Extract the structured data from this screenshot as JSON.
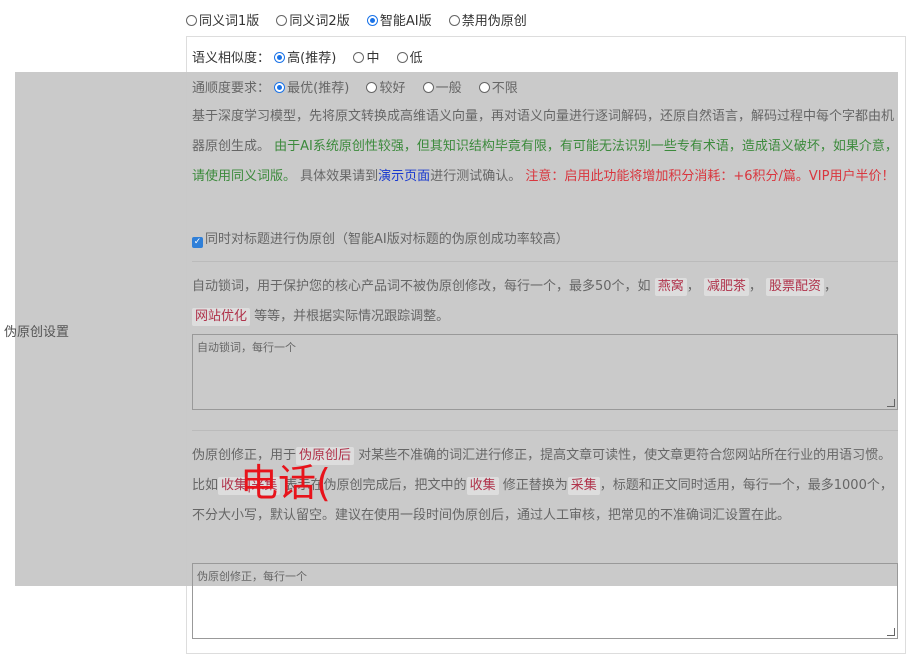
{
  "mode_options": [
    {
      "label": "同义词1版",
      "selected": false
    },
    {
      "label": "同义词2版",
      "selected": false
    },
    {
      "label": "智能AI版",
      "selected": true
    },
    {
      "label": "禁用伪原创",
      "selected": false
    }
  ],
  "similarity": {
    "label": "语义相似度：",
    "options": [
      {
        "label": "高(推荐)",
        "selected": true
      },
      {
        "label": "中",
        "selected": false
      },
      {
        "label": "低",
        "selected": false
      }
    ]
  },
  "fluency": {
    "label": "通顺度要求：",
    "options": [
      {
        "label": "最优(推荐)",
        "selected": true
      },
      {
        "label": "较好",
        "selected": false
      },
      {
        "label": "一般",
        "selected": false
      },
      {
        "label": "不限",
        "selected": false
      }
    ]
  },
  "side_label": "伪原创设置",
  "desc": {
    "p1": "基于深度学习模型，先将原文转换成高维语义向量，再对语义向量进行逐词解码，还原自然语言，解码过程中每个字都由机器原创生成。",
    "p2_green": "由于AI系统原创性较强，但其知识结构毕竟有限，有可能无法识别一些专有术语，造成语义破坏，如果介意，请使用同义词版。",
    "p3a": "具体效果请到",
    "p3_link": "演示页面",
    "p3b": "进行测试确认。",
    "p4_red": "注意：启用此功能将增加积分消耗：+6积分/篇。VIP用户半价！"
  },
  "title_checkbox": {
    "checked": true,
    "label": "同时对标题进行伪原创（智能AI版对标题的伪原创成功率较高）"
  },
  "lock": {
    "text_a": "自动锁词，用于保护您的核心产品词不被伪原创修改，每行一个，最多50个，如",
    "tags": [
      "燕窝",
      "减肥茶",
      "股票配资",
      "网站优化"
    ],
    "text_b": "等等，并根据实际情况跟踪调整。",
    "placeholder": "自动锁词，每行一个"
  },
  "fix": {
    "text_a": "伪原创修正，用于",
    "tag1": "伪原创后",
    "text_b": "对某些不准确的词汇进行修正，提高文章可读性，使文章更符合您网站所在行业的用语习惯。比如",
    "tag2": "收集|采集",
    "text_c": "表示在伪原创完成后，把文中的",
    "tag3": "收集",
    "text_d": "修正替换为",
    "tag4": "采集",
    "text_e": "，标题和正文同时适用，每行一个，最多1000个，不分大小写，默认留空。建议在使用一段时间伪原创后，通过人工审核，把常见的不准确词汇设置在此。",
    "placeholder": "伪原创修正，每行一个"
  },
  "watermark": "电话(",
  "colors": {
    "accent": "#1a73e8",
    "green": "#3c8a3c",
    "red": "#d9363e",
    "link": "#1a3ad0",
    "overlay": "#c8c8c8"
  }
}
